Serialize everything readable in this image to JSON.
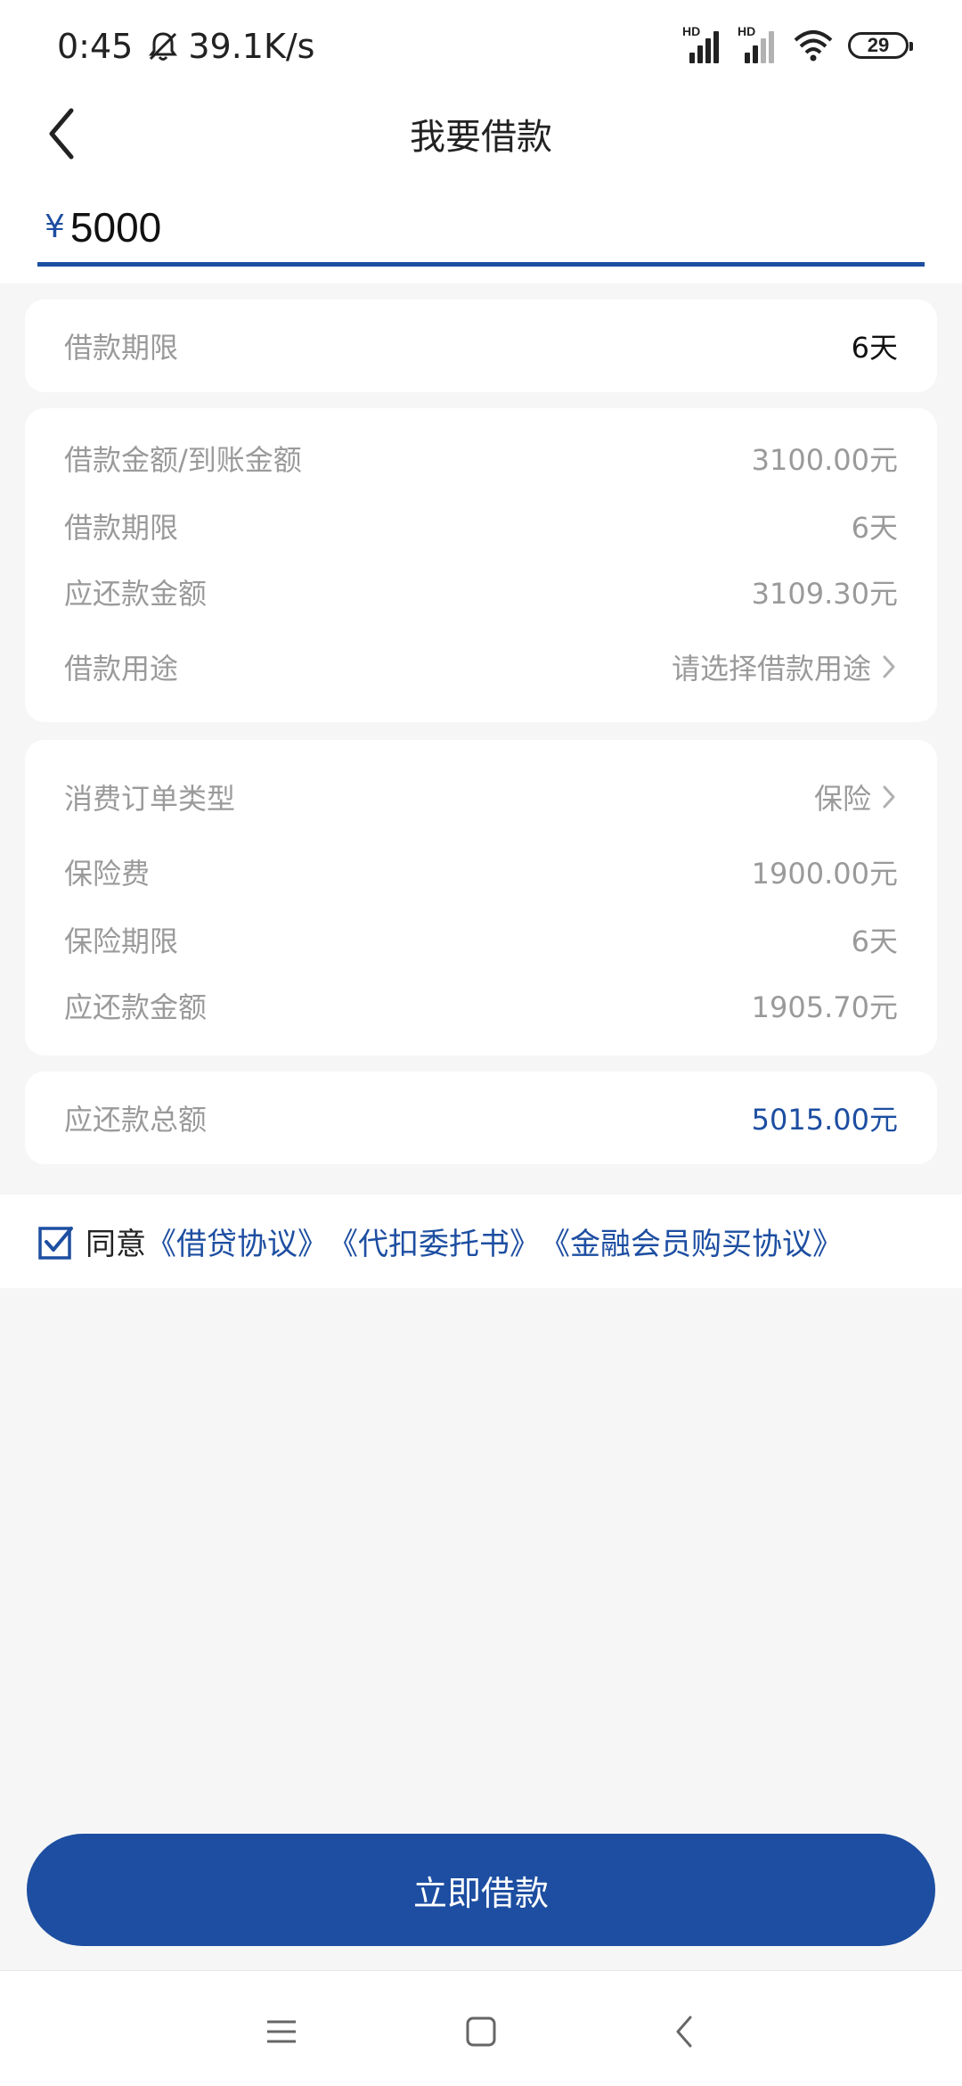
{
  "status_bar": {
    "time": "0:45",
    "net_speed": "39.1K/s",
    "battery": "29",
    "hd_label": "HD"
  },
  "header": {
    "title": "我要借款"
  },
  "amount": {
    "currency": "¥",
    "value": "5000"
  },
  "term_card": {
    "label": "借款期限",
    "value": "6天"
  },
  "loan_card": {
    "rows": [
      {
        "label": "借款金额/到账金额",
        "value": "3100.00元"
      },
      {
        "label": "借款期限",
        "value": "6天"
      },
      {
        "label": "应还款金额",
        "value": "3109.30元"
      },
      {
        "label": "借款用途",
        "value": "请选择借款用途"
      }
    ]
  },
  "order_card": {
    "rows": [
      {
        "label": "消费订单类型",
        "value": "保险"
      },
      {
        "label": "保险费",
        "value": "1900.00元"
      },
      {
        "label": "保险期限",
        "value": "6天"
      },
      {
        "label": "应还款金额",
        "value": "1905.70元"
      }
    ]
  },
  "total_card": {
    "label": "应还款总额",
    "value": "5015.00元"
  },
  "agreement": {
    "checked": true,
    "prefix": "同意",
    "links": [
      "《借贷协议》",
      "《代扣委托书》",
      "《金融会员购买协议》"
    ]
  },
  "submit_label": "立即借款",
  "colors": {
    "accent": "#1d4ea1",
    "muted_text": "#9a9a9a",
    "background": "#f6f6f6"
  },
  "icons": {
    "back": "back-chevron-icon",
    "mute": "bell-off-icon",
    "wifi": "wifi-icon",
    "chevron": "chevron-right-icon",
    "checkbox": "checkbox-checked-icon",
    "nav_menu": "menu-icon",
    "nav_home": "home-square-icon",
    "nav_back": "nav-back-icon"
  }
}
